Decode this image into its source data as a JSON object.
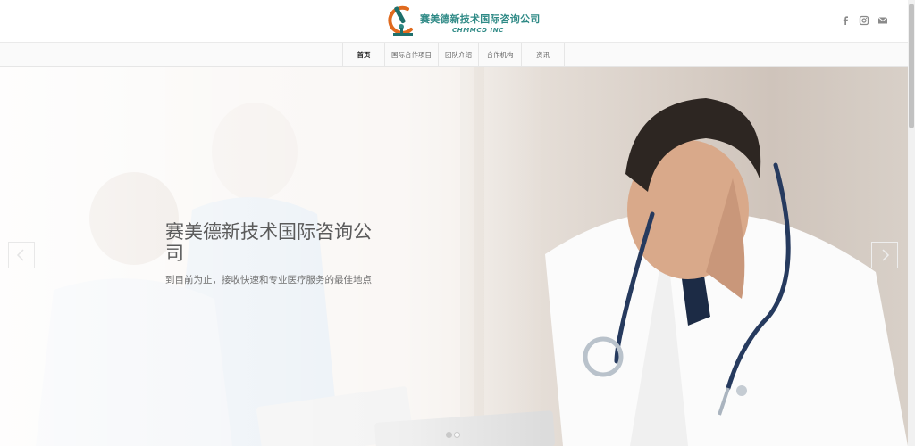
{
  "logo": {
    "name_cn": "赛美德新技术国际咨询公司",
    "name_en": "CHMMCD INC",
    "icon": "microscope-logo-icon"
  },
  "social": [
    {
      "name": "facebook",
      "icon": "facebook-icon"
    },
    {
      "name": "instagram",
      "icon": "instagram-icon"
    },
    {
      "name": "mail",
      "icon": "mail-icon"
    }
  ],
  "nav": {
    "items": [
      {
        "label": "首页",
        "active": true
      },
      {
        "label": "国际合作项目",
        "active": false
      },
      {
        "label": "团队介绍",
        "active": false
      },
      {
        "label": "合作机构",
        "active": false
      },
      {
        "label": "资讯",
        "active": false
      }
    ]
  },
  "hero": {
    "title": "赛美德新技术国际咨询公司",
    "subtitle": "到目前为止，接收快速和专业医疗服务的最佳地点",
    "slides": 2,
    "active_slide": 1
  },
  "colors": {
    "brand": "#2f8a86",
    "accent_orange": "#e06a1e",
    "text": "#5b5b5b"
  }
}
